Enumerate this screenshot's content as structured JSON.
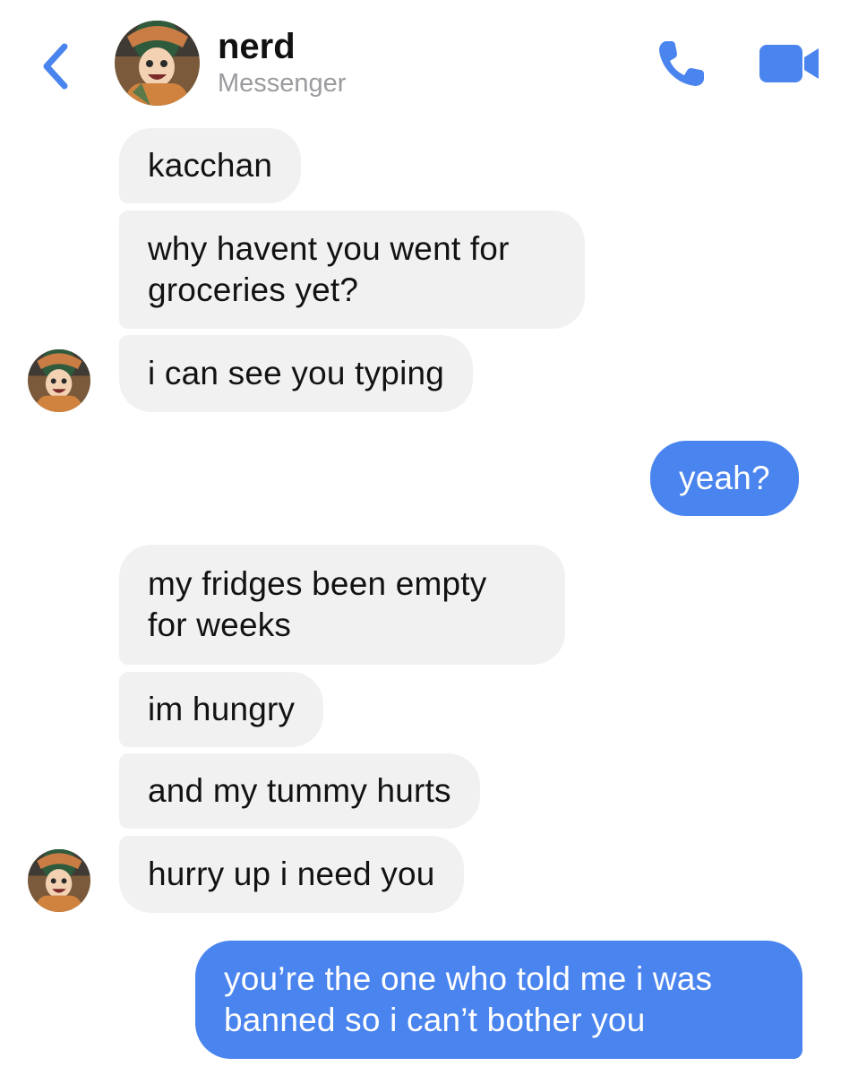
{
  "header": {
    "contact_name": "nerd",
    "subtitle": "Messenger",
    "back_icon": "chevron-left-icon",
    "call_icon": "phone-icon",
    "video_icon": "video-camera-icon",
    "accent_color": "#4a84ee"
  },
  "messages": [
    {
      "direction": "incoming",
      "text": "kacchan"
    },
    {
      "direction": "incoming",
      "lines": [
        "why havent you went for",
        "groceries yet?"
      ]
    },
    {
      "direction": "incoming",
      "text": "i can see you typing",
      "avatar": "contact-avatar"
    },
    {
      "direction": "outgoing",
      "text": "yeah?"
    },
    {
      "direction": "incoming",
      "lines": [
        "my fridges been empty",
        "for weeks"
      ]
    },
    {
      "direction": "incoming",
      "text": "im hungry"
    },
    {
      "direction": "incoming",
      "text": "and my tummy hurts"
    },
    {
      "direction": "incoming",
      "text": "hurry up i need you",
      "avatar": "contact-avatar"
    },
    {
      "direction": "outgoing",
      "lines": [
        "you’re the one who told me i was",
        "banned so i can’t bother you"
      ]
    }
  ],
  "colors": {
    "incoming_bubble": "#f1f1f2",
    "outgoing_bubble": "#4a84ee",
    "subtitle": "#9b9b9f"
  }
}
